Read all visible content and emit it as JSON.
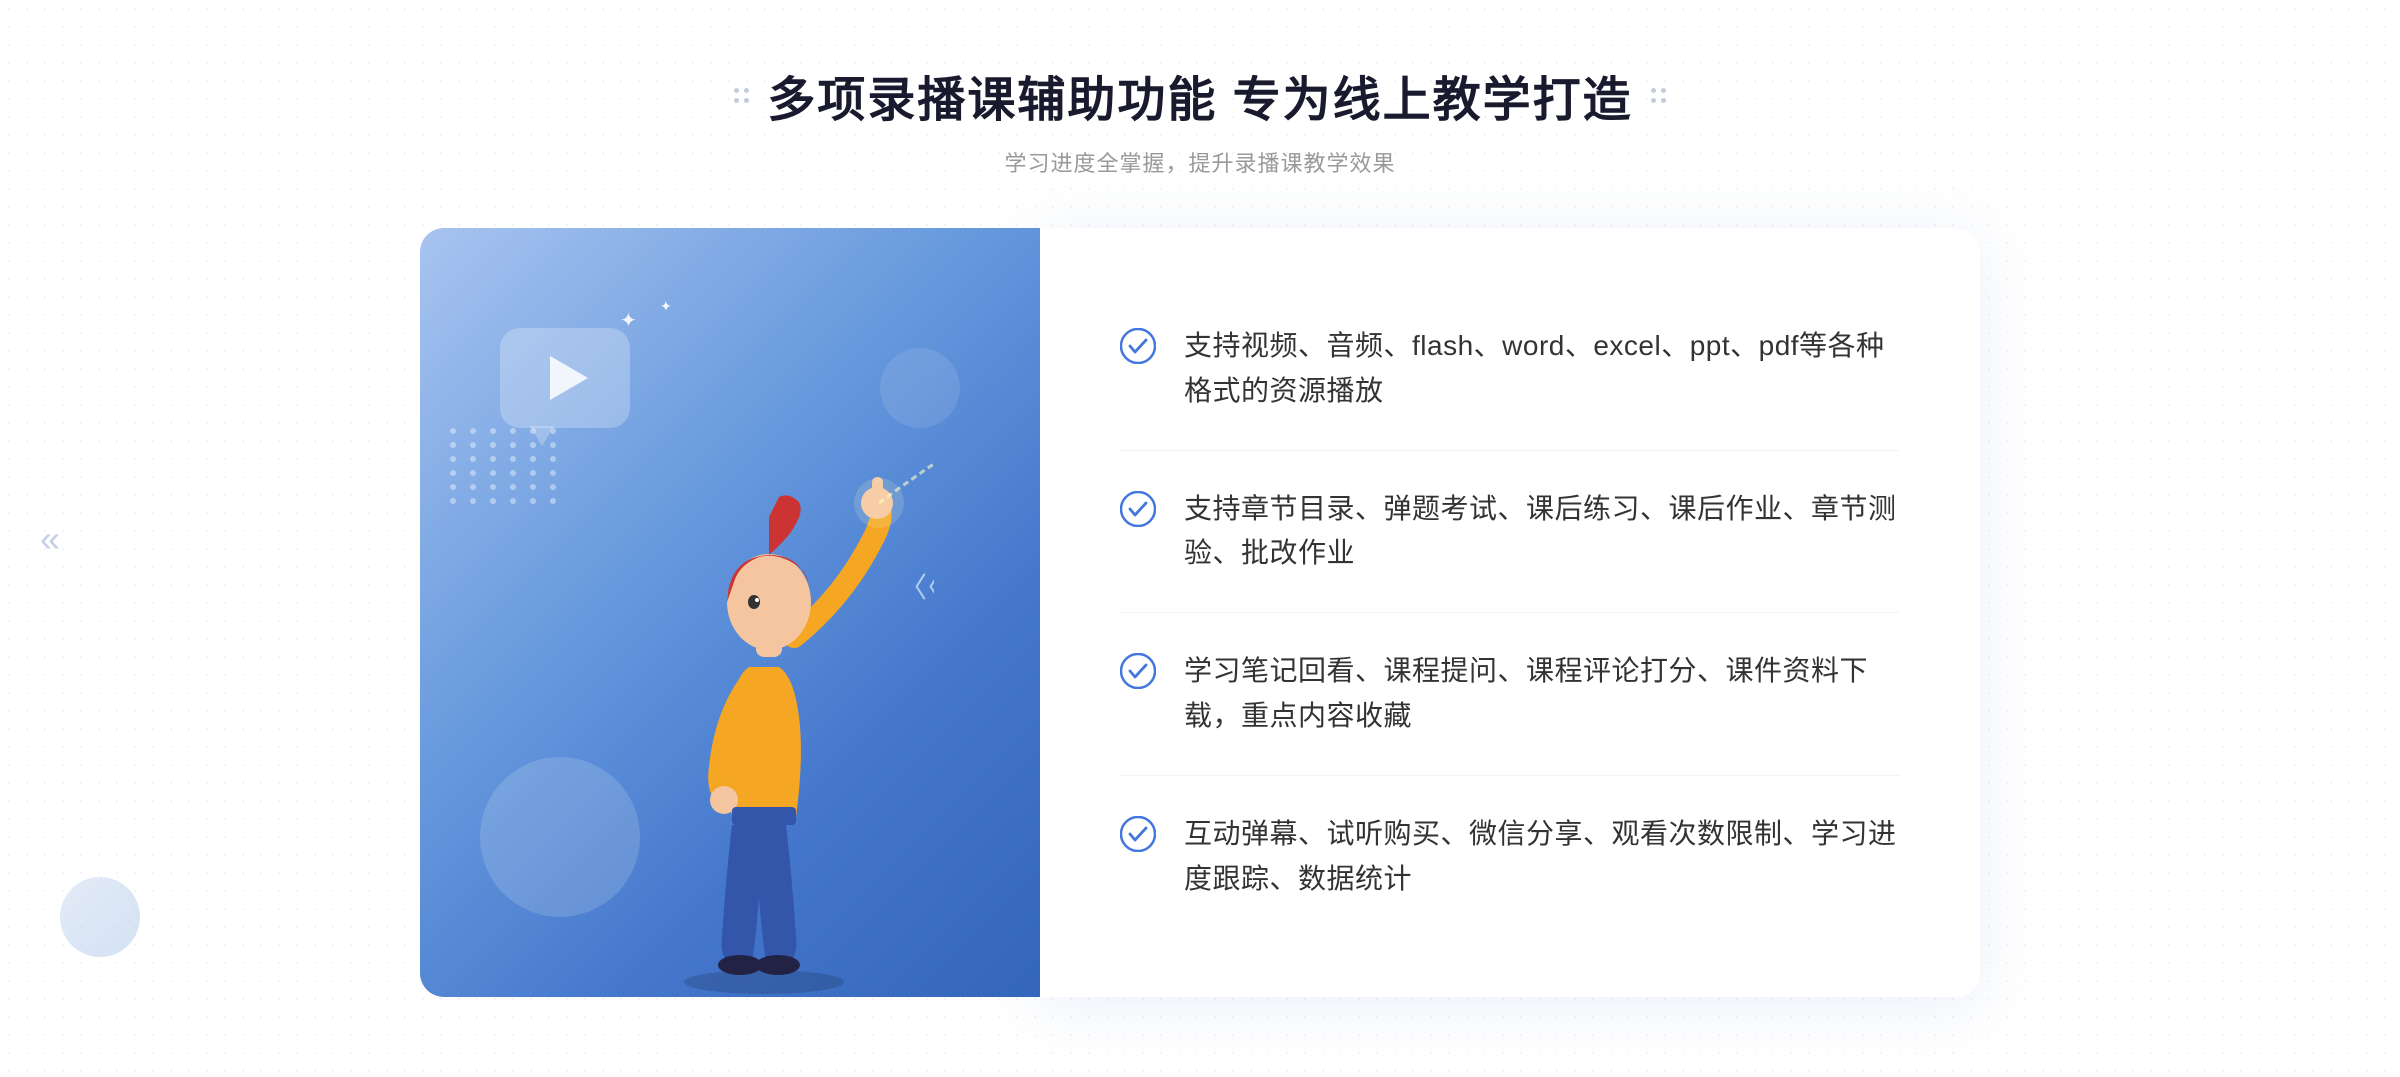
{
  "header": {
    "title": "多项录播课辅助功能 专为线上教学打造",
    "subtitle": "学习进度全掌握，提升录播课教学效果"
  },
  "features": [
    {
      "id": 1,
      "text": "支持视频、音频、flash、word、excel、ppt、pdf等各种格式的资源播放"
    },
    {
      "id": 2,
      "text": "支持章节目录、弹题考试、课后练习、课后作业、章节测验、批改作业"
    },
    {
      "id": 3,
      "text": "学习笔记回看、课程提问、课程评论打分、课件资料下载，重点内容收藏"
    },
    {
      "id": 4,
      "text": "互动弹幕、试听购买、微信分享、观看次数限制、学习进度跟踪、数据统计"
    }
  ],
  "icons": {
    "check": "check-circle",
    "play": "▶",
    "chevron_left": "«",
    "sparkle": "✦"
  },
  "colors": {
    "primary": "#4477dd",
    "primary_light": "#a8c4f0",
    "text_dark": "#1a1a2e",
    "text_normal": "#333333",
    "text_light": "#999999",
    "check_color": "#4477dd",
    "bg_white": "#ffffff"
  }
}
